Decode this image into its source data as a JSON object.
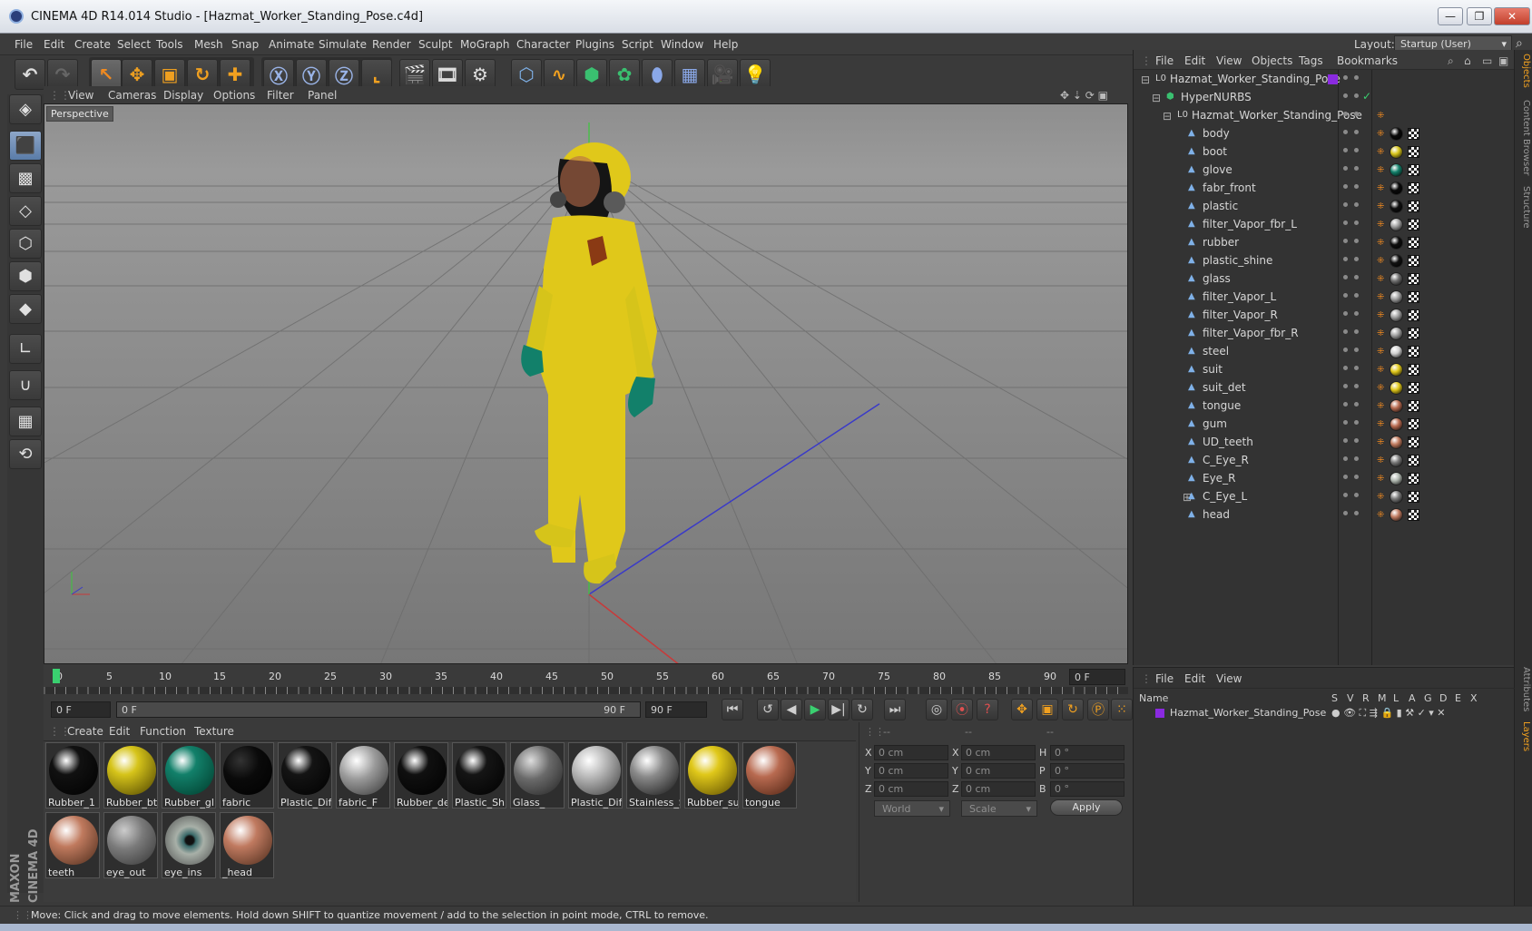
{
  "window": {
    "title": "CINEMA 4D R14.014 Studio - [Hazmat_Worker_Standing_Pose.c4d]",
    "minimize": "—",
    "restore": "❐",
    "close": "✕"
  },
  "menubar": {
    "items": [
      "File",
      "Edit",
      "Create",
      "Select",
      "Tools",
      "Mesh",
      "Snap",
      "Animate",
      "Simulate",
      "Render",
      "Sculpt",
      "MoGraph",
      "Character",
      "Plugins",
      "Script",
      "Window",
      "Help"
    ],
    "layout_label": "Layout:",
    "layout_value": "Startup (User)"
  },
  "viewport": {
    "menu": [
      "View",
      "Cameras",
      "Display",
      "Options",
      "Filter",
      "Panel"
    ],
    "label": "Perspective"
  },
  "timeline": {
    "ticks": [
      "0",
      "5",
      "10",
      "15",
      "20",
      "25",
      "30",
      "35",
      "40",
      "45",
      "50",
      "55",
      "60",
      "65",
      "70",
      "75",
      "80",
      "85",
      "90"
    ],
    "current_frame": "0 F",
    "start_field": "0 F",
    "slider_start": "0 F",
    "slider_end": "90 F",
    "end_field": "90 F"
  },
  "materials": {
    "menu": [
      "Create",
      "Edit",
      "Function",
      "Texture"
    ],
    "items": [
      {
        "label": "Rubber_1",
        "color": "#111111"
      },
      {
        "label": "Rubber_bt",
        "color": "#d6c41a"
      },
      {
        "label": "Rubber_gl",
        "color": "#12806a"
      },
      {
        "label": "fabric",
        "color": "#0a0a0a"
      },
      {
        "label": "Plastic_Diff",
        "color": "#141414"
      },
      {
        "label": "fabric_F",
        "color": "#9a9a9a"
      },
      {
        "label": "Rubber_de",
        "color": "#101010"
      },
      {
        "label": "Plastic_Shir",
        "color": "#151515"
      },
      {
        "label": "Glass_",
        "color": "#6a6a6a"
      },
      {
        "label": "Plastic_Diff",
        "color": "#b0b0b0"
      },
      {
        "label": "Stainless_S",
        "color": "#8a8a8a"
      },
      {
        "label": "Rubber_su",
        "color": "#e0c81a"
      },
      {
        "label": "tongue",
        "color": "#b86a50"
      },
      {
        "label": "teeth",
        "color": "#c07a5e"
      },
      {
        "label": "eye_out",
        "color": "#7a7a7a"
      },
      {
        "label": "eye_ins",
        "color": "#a8b0a8"
      },
      {
        "label": "_head",
        "color": "#c07a60"
      }
    ]
  },
  "coords": {
    "headers": [
      "--",
      "--",
      "--"
    ],
    "rows": [
      {
        "a": "X",
        "av": "0 cm",
        "b": "X",
        "bv": "0 cm",
        "c": "H",
        "cv": "0 °"
      },
      {
        "a": "Y",
        "av": "0 cm",
        "b": "Y",
        "bv": "0 cm",
        "c": "P",
        "cv": "0 °"
      },
      {
        "a": "Z",
        "av": "0 cm",
        "b": "Z",
        "bv": "0 cm",
        "c": "B",
        "cv": "0 °"
      }
    ],
    "space": "World",
    "mode": "Scale",
    "apply": "Apply"
  },
  "objects": {
    "menu": [
      "File",
      "Edit",
      "View",
      "Objects",
      "Tags",
      "Bookmarks"
    ],
    "items": [
      {
        "name": "Hazmat_Worker_Standing_Pose",
        "indent": 0,
        "icon": "null"
      },
      {
        "name": "HyperNURBS",
        "indent": 1,
        "icon": "nurbs"
      },
      {
        "name": "Hazmat_Worker_Standing_Pose",
        "indent": 2,
        "icon": "null"
      },
      {
        "name": "body",
        "indent": 3,
        "tag": "#0a0a0a"
      },
      {
        "name": "boot",
        "indent": 3,
        "tag": "#d6c41a"
      },
      {
        "name": "glove",
        "indent": 3,
        "tag": "#12806a"
      },
      {
        "name": "fabr_front",
        "indent": 3,
        "tag": "#0a0a0a"
      },
      {
        "name": "plastic",
        "indent": 3,
        "tag": "#101010"
      },
      {
        "name": "filter_Vapor_fbr_L",
        "indent": 3,
        "tag": "#a0a0a0"
      },
      {
        "name": "rubber",
        "indent": 3,
        "tag": "#0e0e0e"
      },
      {
        "name": "plastic_shine",
        "indent": 3,
        "tag": "#121212"
      },
      {
        "name": "glass",
        "indent": 3,
        "tag": "#6e6e6e"
      },
      {
        "name": "filter_Vapor_L",
        "indent": 3,
        "tag": "#a0a0a0"
      },
      {
        "name": "filter_Vapor_R",
        "indent": 3,
        "tag": "#a0a0a0"
      },
      {
        "name": "filter_Vapor_fbr_R",
        "indent": 3,
        "tag": "#a0a0a0"
      },
      {
        "name": "steel",
        "indent": 3,
        "tag": "#d0d0d0"
      },
      {
        "name": "suit",
        "indent": 3,
        "tag": "#e0c81a"
      },
      {
        "name": "suit_det",
        "indent": 3,
        "tag": "#e0c81a"
      },
      {
        "name": "tongue",
        "indent": 3,
        "tag": "#b86a50"
      },
      {
        "name": "gum",
        "indent": 3,
        "tag": "#b86a50"
      },
      {
        "name": "UD_teeth",
        "indent": 3,
        "tag": "#c07a5e"
      },
      {
        "name": "C_Eye_R",
        "indent": 3,
        "tag": "#7a7a7a"
      },
      {
        "name": "Eye_R",
        "indent": 3,
        "tag": "#b0b8b0"
      },
      {
        "name": "C_Eye_L",
        "indent": 3,
        "tag": "#7a7a7a"
      },
      {
        "name": "head",
        "indent": 3,
        "tag": "#c07a60"
      }
    ]
  },
  "layers": {
    "menu": [
      "File",
      "Edit",
      "View"
    ],
    "name_header": "Name",
    "cols": [
      "S",
      "V",
      "R",
      "M",
      "L",
      "A",
      "G",
      "D",
      "E",
      "X"
    ],
    "row": "Hazmat_Worker_Standing_Pose"
  },
  "sidetabs": [
    "Objects",
    "Content Browser",
    "Structure",
    "Attributes",
    "Layers"
  ],
  "branding": "MAXON CINEMA 4D",
  "status": "Move: Click and drag to move elements. Hold down SHIFT to quantize movement / add to the selection in point mode, CTRL to remove.",
  "colors": {
    "accent": "#f08a20",
    "selection": "#8da6c8",
    "suit": "#e0c81a"
  }
}
